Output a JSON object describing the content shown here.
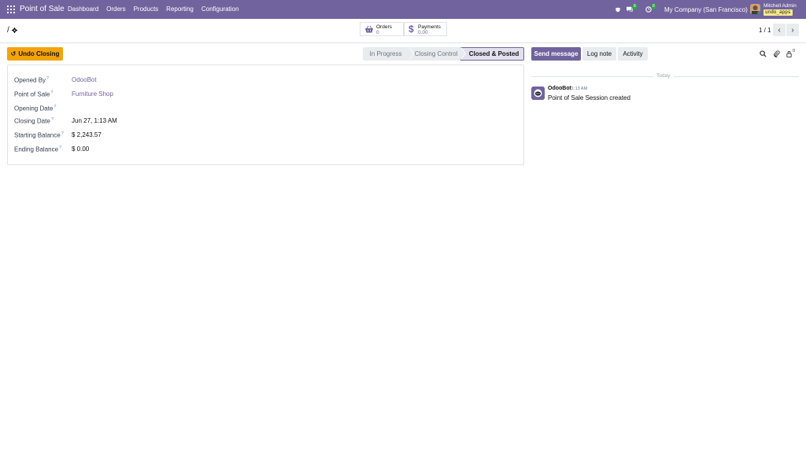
{
  "navbar": {
    "app_title": "Point of Sale",
    "menu": [
      "Dashboard",
      "Orders",
      "Products",
      "Reporting",
      "Configuration"
    ],
    "messages_badge": "8",
    "activities_badge": "8",
    "company": "My Company (San Francisco)",
    "user_name": "Mitchell Admin",
    "database": "undo_apps"
  },
  "breadcrumb": {
    "title": "/"
  },
  "stats": {
    "orders": {
      "label": "Orders",
      "value": "0"
    },
    "payments": {
      "label": "Payments",
      "value": "0.00"
    }
  },
  "pager": {
    "value": "1 / 1",
    "prev": "‹",
    "next": "›"
  },
  "actions": {
    "undo_closing": "Undo Closing"
  },
  "statusbar": {
    "stages": [
      "In Progress",
      "Closing Control",
      "Closed & Posted"
    ],
    "active": "Closed & Posted"
  },
  "form": {
    "fields": [
      {
        "label": "Opened By",
        "value": "OdooBot",
        "link": true
      },
      {
        "label": "Point of Sale",
        "value": "Furniture Shop",
        "link": true
      },
      {
        "label": "Opening Date",
        "value": "",
        "link": false
      },
      {
        "label": "Closing Date",
        "value": "Jun 27, 1:13 AM",
        "link": false
      },
      {
        "label": "Starting Balance",
        "value": "$ 2,243.57",
        "link": false
      },
      {
        "label": "Ending Balance",
        "value": "$ 0.00",
        "link": false
      }
    ],
    "help_marker": "?"
  },
  "chatter": {
    "send_message": "Send message",
    "log_note": "Log note",
    "activity": "Activity",
    "followers_count": "0",
    "date_separator": "Today",
    "message": {
      "author": "OdooBot",
      "time": "1:13 AM",
      "body": "Point of Sale Session created"
    }
  },
  "colors": {
    "brand": "#71639e",
    "primary_action": "#f3a40b",
    "badge": "#28a745"
  }
}
